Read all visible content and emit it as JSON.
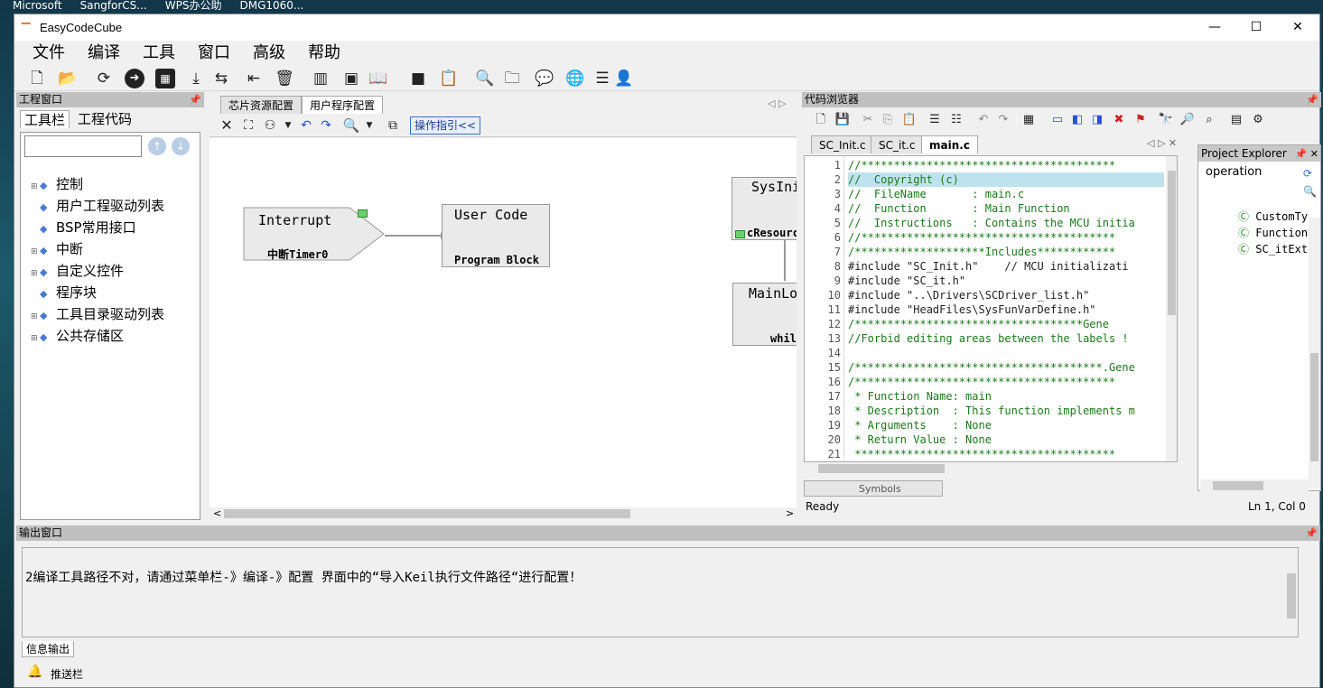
{
  "os_taskbar": {
    "items": [
      "Microsoft",
      "SangforCS...",
      "WPS办公助",
      "DMG1060..."
    ]
  },
  "window": {
    "title": "EasyCodeCube",
    "min_glyph": "—",
    "max_glyph": "☐",
    "close_glyph": "✕"
  },
  "menu": {
    "items": [
      "文件",
      "编译",
      "工具",
      "窗口",
      "高级",
      "帮助"
    ]
  },
  "project_window": {
    "title": "工程窗口",
    "pin": "📌",
    "tabs": [
      "工具栏",
      "工程代码"
    ],
    "search_value": "",
    "up_glyph": "↑",
    "down_glyph": "↓",
    "tree": [
      {
        "label": "控制",
        "expandable": true
      },
      {
        "label": "用户工程驱动列表",
        "expandable": false
      },
      {
        "label": "BSP常用接口",
        "expandable": false
      },
      {
        "label": "中断",
        "expandable": true
      },
      {
        "label": "自定义控件",
        "expandable": true
      },
      {
        "label": "程序块",
        "expandable": false
      },
      {
        "label": "工具目录驱动列表",
        "expandable": true
      },
      {
        "label": "公共存储区",
        "expandable": true
      }
    ]
  },
  "editor": {
    "tabs": [
      "芯片资源配置",
      "用户程序配置"
    ],
    "active_tab": 1,
    "guide_button": "操作指引<<",
    "blocks": {
      "interrupt": {
        "title": "Interrupt",
        "sub": "中断Timer0"
      },
      "usercode": {
        "title": "User Code",
        "sub": "Program Block"
      },
      "sysinit": {
        "title": "SysInit",
        "sub": "cResourceI"
      },
      "mainloop": {
        "title": "MainLoop",
        "sub": "while"
      }
    }
  },
  "code_browser": {
    "title": "代码浏览器",
    "files": [
      "SC_Init.c",
      "SC_it.c",
      "main.c"
    ],
    "active_file": 2,
    "lines": [
      "//***************************************",
      "//  Copyright (c)",
      "//  FileName       : main.c",
      "//  Function       : Main Function",
      "//  Instructions   : Contains the MCU initia",
      "//***************************************",
      "/********************Includes************",
      "#include \"SC_Init.h\"    // MCU initializati",
      "#include \"SC_it.h\"",
      "#include \"..\\Drivers\\SCDriver_list.h\"",
      "#include \"HeadFiles\\SysFunVarDefine.h\"",
      "/***********************************Gene",
      "//Forbid editing areas between the labels !",
      "",
      "/**************************************.Gene",
      "/****************************************",
      " * Function Name: main",
      " * Description  : This function implements m",
      " * Arguments    : None",
      " * Return Value : None",
      " ****************************************"
    ],
    "symbols_tab": "Symbols",
    "status_left": "Ready",
    "status_right": "Ln 1, Col 0"
  },
  "project_explorer": {
    "title": "Project Explorer",
    "root": "operation",
    "items": [
      "CustomTy",
      "Function",
      "SC_itExt"
    ]
  },
  "output": {
    "title": "输出窗口",
    "message": "2编译工具路径不对，请通过菜单栏-》编译-》配置 界面中的“导入Keil执行文件路径“进行配置！",
    "tab": "信息输出",
    "push_label": "推送栏"
  }
}
